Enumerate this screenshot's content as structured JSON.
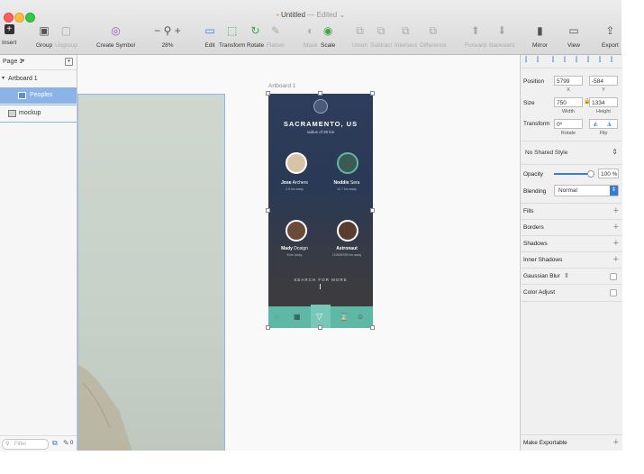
{
  "window": {
    "title": "Untitled",
    "edited": "— Edited"
  },
  "toolbar": {
    "insert": "Insert",
    "group": "Group",
    "ungroup": "Ungroup",
    "create_symbol": "Create Symbol",
    "zoom": "28%",
    "edit": "Edit",
    "transform": "Transform",
    "rotate": "Rotate",
    "flatten": "Flatten",
    "mask": "Mask",
    "scale": "Scale",
    "union": "Union",
    "subtract": "Subtract",
    "intersect": "Intersect",
    "difference": "Difference",
    "forward": "Forward",
    "backward": "Backward",
    "mirror": "Mirror",
    "view": "View",
    "export": "Export"
  },
  "sidebar": {
    "page": "Page 1",
    "layers": [
      {
        "label": "Artboard 1"
      },
      {
        "label": "Peoples"
      },
      {
        "label": "mockup"
      }
    ],
    "filter_placeholder": "Filter",
    "count": "0"
  },
  "canvas": {
    "artboard_label": "Artboard 1",
    "app": {
      "city": "SACRAMENTO, US",
      "radius": "radius of 30 km",
      "people": [
        {
          "first": "Jose",
          "last": "Archers",
          "distance": "2.5 km away"
        },
        {
          "first": "Noddie",
          "last": "Sera",
          "distance": "12.7 km away"
        },
        {
          "first": "Mady",
          "last": "Dosign",
          "distance": "8 km away"
        },
        {
          "first": "Astronaut",
          "last": "",
          "distance": "123456789 km away"
        }
      ],
      "search_more": "SEARCH FOR MORE",
      "tab_accent": "#5fb8a5"
    }
  },
  "inspector": {
    "position_label": "Position",
    "pos_x": "5799",
    "pos_y": "-584",
    "x_label": "X",
    "y_label": "Y",
    "size_label": "Size",
    "width": "750",
    "height": "1334",
    "width_label": "Width",
    "height_label": "Height",
    "transform_label": "Transform",
    "rotate_value": "0º",
    "rotate_label": "Rotate",
    "flip_label": "Flip",
    "shared_style": "No Shared Style",
    "opacity_label": "Opacity",
    "opacity_value": "100 %",
    "opacity_level": 1.0,
    "blending_label": "Blending",
    "blending_value": "Normal",
    "sections": [
      "Fills",
      "Borders",
      "Shadows",
      "Inner Shadows",
      "Gaussian Blur",
      "Color Adjust"
    ],
    "make_exportable": "Make Exportable"
  }
}
